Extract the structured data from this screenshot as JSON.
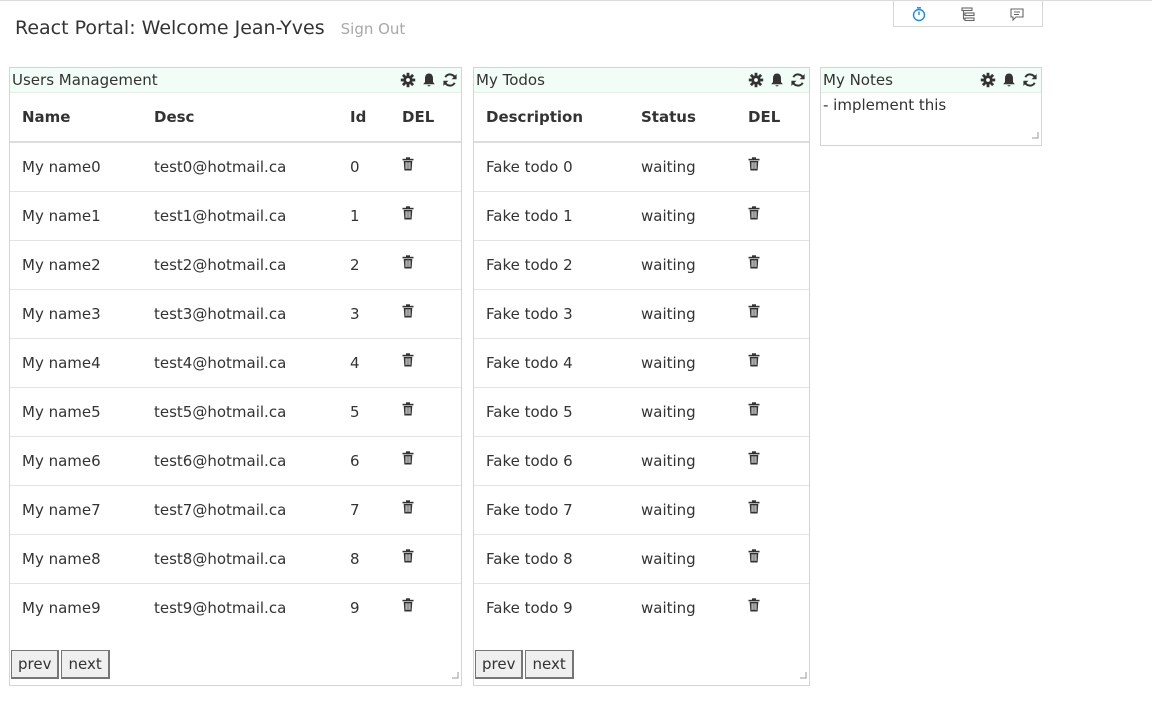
{
  "header": {
    "title": "React Portal: Welcome Jean-Yves",
    "signout_label": "Sign Out"
  },
  "devtools": {
    "icons": [
      "timer-icon",
      "tree-icon",
      "comment-icon"
    ],
    "accent": "#1e88e5"
  },
  "users_panel": {
    "title": "Users Management",
    "columns": [
      "Name",
      "Desc",
      "Id",
      "DEL"
    ],
    "rows": [
      {
        "name": "My name0",
        "desc": "test0@hotmail.ca",
        "id": "0"
      },
      {
        "name": "My name1",
        "desc": "test1@hotmail.ca",
        "id": "1"
      },
      {
        "name": "My name2",
        "desc": "test2@hotmail.ca",
        "id": "2"
      },
      {
        "name": "My name3",
        "desc": "test3@hotmail.ca",
        "id": "3"
      },
      {
        "name": "My name4",
        "desc": "test4@hotmail.ca",
        "id": "4"
      },
      {
        "name": "My name5",
        "desc": "test5@hotmail.ca",
        "id": "5"
      },
      {
        "name": "My name6",
        "desc": "test6@hotmail.ca",
        "id": "6"
      },
      {
        "name": "My name7",
        "desc": "test7@hotmail.ca",
        "id": "7"
      },
      {
        "name": "My name8",
        "desc": "test8@hotmail.ca",
        "id": "8"
      },
      {
        "name": "My name9",
        "desc": "test9@hotmail.ca",
        "id": "9"
      }
    ],
    "prev_label": "prev",
    "next_label": "next"
  },
  "todos_panel": {
    "title": "My Todos",
    "columns": [
      "Description",
      "Status",
      "DEL"
    ],
    "rows": [
      {
        "description": "Fake todo 0",
        "status": "waiting"
      },
      {
        "description": "Fake todo 1",
        "status": "waiting"
      },
      {
        "description": "Fake todo 2",
        "status": "waiting"
      },
      {
        "description": "Fake todo 3",
        "status": "waiting"
      },
      {
        "description": "Fake todo 4",
        "status": "waiting"
      },
      {
        "description": "Fake todo 5",
        "status": "waiting"
      },
      {
        "description": "Fake todo 6",
        "status": "waiting"
      },
      {
        "description": "Fake todo 7",
        "status": "waiting"
      },
      {
        "description": "Fake todo 8",
        "status": "waiting"
      },
      {
        "description": "Fake todo 9",
        "status": "waiting"
      }
    ],
    "prev_label": "prev",
    "next_label": "next"
  },
  "notes_panel": {
    "title": "My Notes",
    "content": "- implement this"
  },
  "panel_tool_icons": [
    "gear-icon",
    "bell-icon",
    "refresh-icon"
  ],
  "colors": {
    "panel_header_bg": "#f2fdf7",
    "signout": "#a8a8a8"
  }
}
